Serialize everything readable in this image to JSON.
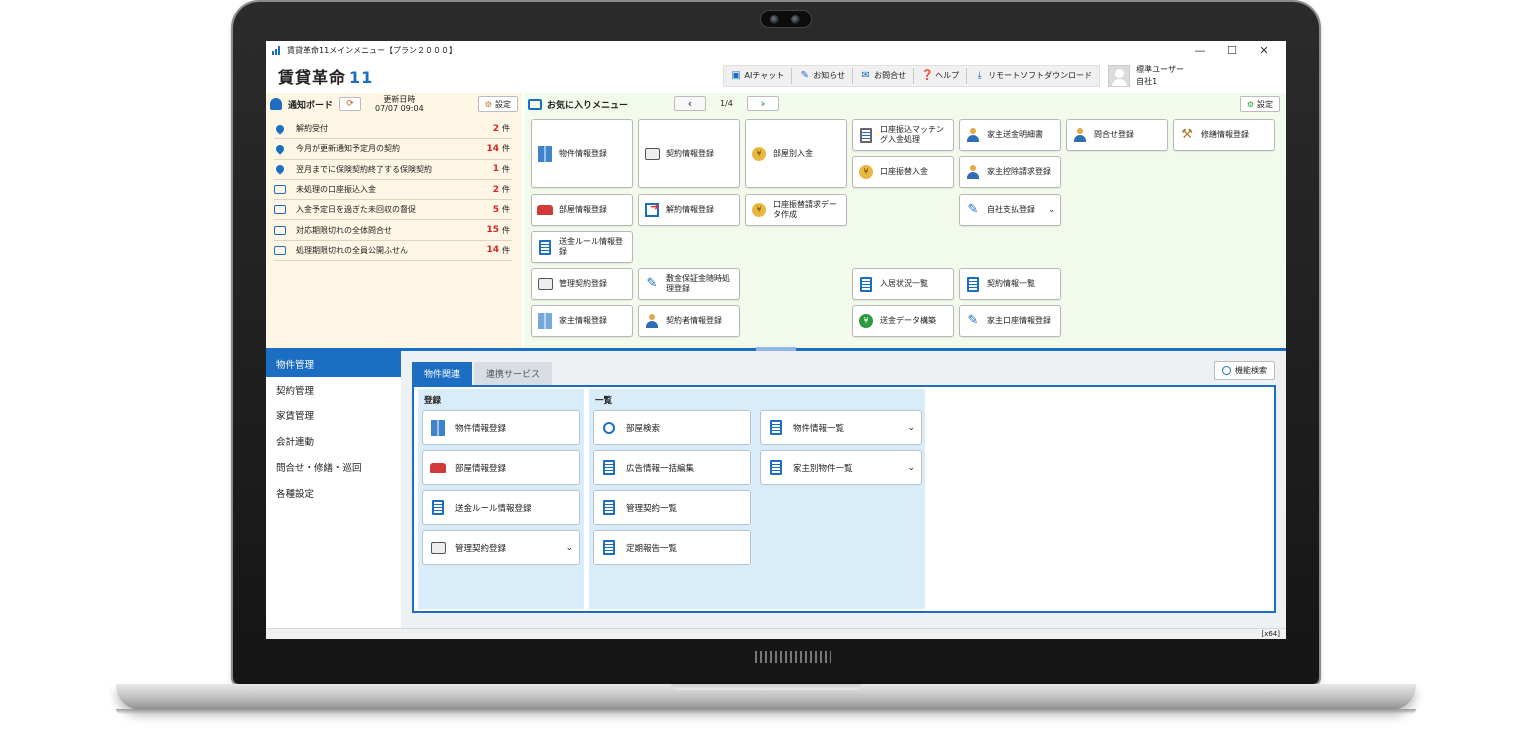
{
  "window": {
    "title": "賃貸革命11メインメニュー【プラン２０００】",
    "controls": [
      "—",
      "☐",
      "✕"
    ]
  },
  "header": {
    "logo_text": "賃貸革命",
    "logo_num": "11",
    "tools": [
      {
        "label": "AIチャット",
        "icon": "ai-chat-icon"
      },
      {
        "label": "お知らせ",
        "icon": "notice-icon"
      },
      {
        "label": "お問合せ",
        "icon": "mail-icon"
      },
      {
        "label": "ヘルプ",
        "icon": "help-icon"
      },
      {
        "label": "リモートソフトダウンロード",
        "icon": "download-icon"
      }
    ],
    "user_name": "標準ユーザー",
    "user_company": "自社1"
  },
  "notify_board": {
    "title": "通知ボード",
    "updated_label": "更新日時",
    "updated_value": "07/07 09:04",
    "settings_label": "設定",
    "unit": "件",
    "items": [
      {
        "label": "解約受付",
        "count": "2"
      },
      {
        "label": "今月が更新通知予定月の契約",
        "count": "14"
      },
      {
        "label": "翌月までに保険契約終了する保険契約",
        "count": "1"
      },
      {
        "label": "未処理の口座振込入金",
        "count": "2"
      },
      {
        "label": "入金予定日を過ぎた未回収の督促",
        "count": "5"
      },
      {
        "label": "対応期限切れの全体問合せ",
        "count": "15"
      },
      {
        "label": "処理期限切れの全員公開ふせん",
        "count": "14"
      }
    ]
  },
  "favorites": {
    "title": "お気に入りメニュー",
    "page": "1/4",
    "settings_label": "設定",
    "buttons": [
      {
        "label": "物件情報登録"
      },
      {
        "label": "契約情報登録"
      },
      {
        "label": "部屋別入金"
      },
      {
        "label": "口座振込マッチング入金処理"
      },
      {
        "label": "家主送金明細書"
      },
      {
        "label": "問合せ登録"
      },
      {
        "label": "修繕情報登録"
      },
      {
        "label": "口座振替入金"
      },
      {
        "label": "家主控除請求登録"
      },
      {
        "label": "部屋情報登録"
      },
      {
        "label": "解約情報登録"
      },
      {
        "label": "口座振替請求データ作成"
      },
      {
        "label": "自社支払登録"
      },
      {
        "label": "送金ルール情報登録"
      },
      {
        "label": "管理契約登録"
      },
      {
        "label": "敷金保証金随時処理登録"
      },
      {
        "label": "入居状況一覧"
      },
      {
        "label": "契約情報一覧"
      },
      {
        "label": "家主情報登録"
      },
      {
        "label": "契約者情報登録"
      },
      {
        "label": "送金データ構築"
      },
      {
        "label": "家主口座情報登録"
      }
    ]
  },
  "side_nav": {
    "items": [
      "物件管理",
      "契約管理",
      "家賃管理",
      "会計連動",
      "問合せ・修繕・巡回",
      "各種設定"
    ]
  },
  "main": {
    "tabs": [
      "物件関連",
      "連携サービス"
    ],
    "search_label": "機能検索",
    "groups": [
      {
        "title": "登録",
        "items": [
          "物件情報登録",
          "部屋情報登録",
          "送金ルール情報登録",
          "管理契約登録"
        ]
      },
      {
        "title": "一覧",
        "items": [
          "部屋検索",
          "広告情報一括編集",
          "管理契約一覧",
          "定期報告一覧"
        ]
      },
      {
        "items": [
          "物件情報一覧",
          "家主別物件一覧"
        ]
      }
    ]
  },
  "status_bar": {
    "text": "[x64]"
  }
}
